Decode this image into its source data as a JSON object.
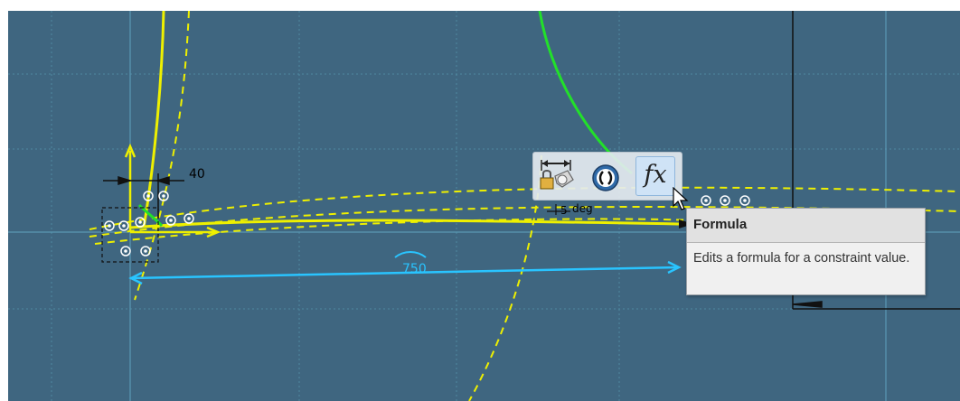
{
  "sketch": {
    "dimensions": {
      "horizontal_offset": "40",
      "main_distance": "750",
      "small_value": "5",
      "small_suffix": "deg"
    },
    "colors": {
      "background": "#3f6680",
      "grid_line": "#4f88a0",
      "construction": "#eef000",
      "selected_curve": "#22e02a",
      "dimension_cyan": "#29c4ff",
      "axis": "#111111"
    }
  },
  "toolbar": {
    "buttons": [
      {
        "name": "lock-dimension",
        "icon": "lock-dimension-icon",
        "active": false
      },
      {
        "name": "reference",
        "icon": "reference-parentheses-icon",
        "active": false
      },
      {
        "name": "formula",
        "icon": "formula-fx-icon",
        "label": "fx",
        "active": true
      }
    ]
  },
  "tooltip": {
    "title": "Formula",
    "description": "Edits a formula for a constraint value."
  }
}
